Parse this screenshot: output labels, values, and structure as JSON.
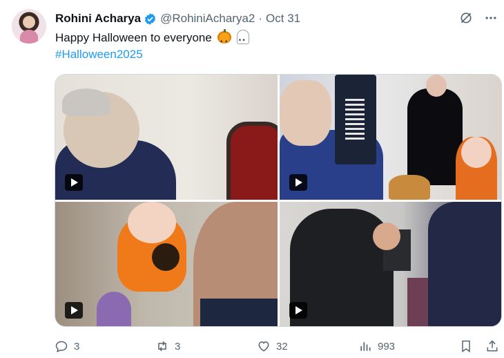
{
  "tweet": {
    "author_name": "Rohini Acharya",
    "handle": "@RohiniAcharya2",
    "separator": "·",
    "date": "Oct 31",
    "text": "Happy Halloween to everyone",
    "hashtag": "#Halloween2025",
    "icons": [
      "grok-icon",
      "more-icon"
    ],
    "verified_color": "#1d9bf0"
  },
  "media": {
    "tiles": [
      {
        "name": "video-1",
        "type": "video"
      },
      {
        "name": "video-2",
        "type": "video"
      },
      {
        "name": "video-3",
        "type": "video"
      },
      {
        "name": "video-4",
        "type": "video"
      }
    ]
  },
  "actions": {
    "replies": "3",
    "reposts": "3",
    "likes": "32",
    "views": "993",
    "icons": [
      "reply-icon",
      "repost-icon",
      "like-icon",
      "views-icon",
      "bookmark-icon",
      "share-icon"
    ]
  }
}
